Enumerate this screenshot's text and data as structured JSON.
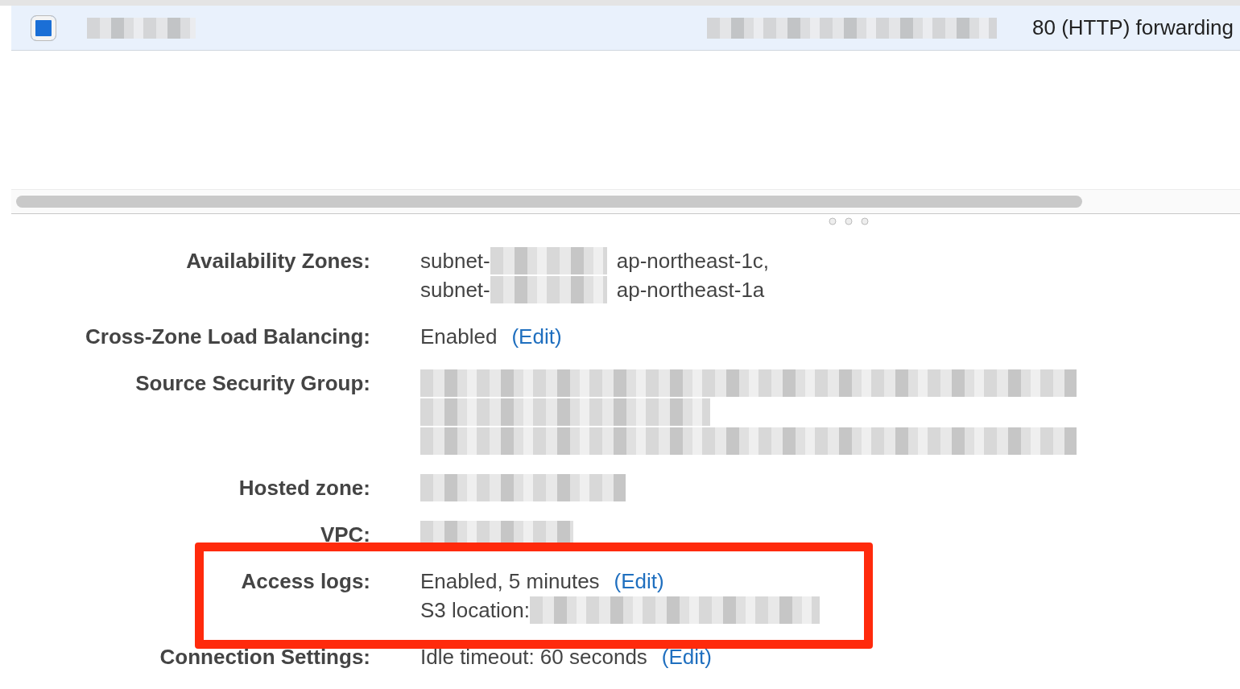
{
  "table": {
    "rows": [
      {
        "checked": true,
        "cells": [
          {
            "kind": "redacted"
          },
          {
            "kind": "redacted"
          },
          {
            "kind": "text",
            "text": "80 (HTTP) forwarding"
          }
        ]
      }
    ]
  },
  "details": [
    {
      "label": "Availability Zones:",
      "highlighted": false,
      "lines": [
        [
          {
            "kind": "text",
            "text": "subnet-"
          },
          {
            "kind": "redacted"
          },
          {
            "kind": "text",
            "text": "ap-northeast-1c,"
          }
        ],
        [
          {
            "kind": "text",
            "text": "subnet-"
          },
          {
            "kind": "redacted"
          },
          {
            "kind": "text",
            "text": "ap-northeast-1a"
          }
        ]
      ]
    },
    {
      "label": "Cross-Zone Load Balancing:",
      "highlighted": false,
      "lines": [
        [
          {
            "kind": "text",
            "text": "Enabled"
          },
          {
            "kind": "link",
            "text": "(Edit)"
          }
        ]
      ]
    },
    {
      "label": "Source Security Group:",
      "highlighted": false,
      "lines": [
        [
          {
            "kind": "redacted"
          }
        ],
        [
          {
            "kind": "redacted"
          }
        ],
        [
          {
            "kind": "redacted"
          }
        ]
      ]
    },
    {
      "label": "Hosted zone:",
      "highlighted": false,
      "lines": [
        [
          {
            "kind": "redacted"
          }
        ]
      ]
    },
    {
      "label": "VPC:",
      "highlighted": false,
      "lines": [
        [
          {
            "kind": "redacted"
          }
        ]
      ]
    },
    {
      "label": "Access logs:",
      "highlighted": true,
      "lines": [
        [
          {
            "kind": "text",
            "text": "Enabled, 5 minutes"
          },
          {
            "kind": "link",
            "text": "(Edit)"
          }
        ],
        [
          {
            "kind": "text",
            "text": "S3 location:"
          },
          {
            "kind": "redacted"
          }
        ]
      ]
    },
    {
      "label": "Connection Settings:",
      "highlighted": false,
      "lines": [
        [
          {
            "kind": "text",
            "text": "Idle timeout: 60 seconds"
          },
          {
            "kind": "link",
            "text": "(Edit)"
          }
        ]
      ]
    }
  ]
}
